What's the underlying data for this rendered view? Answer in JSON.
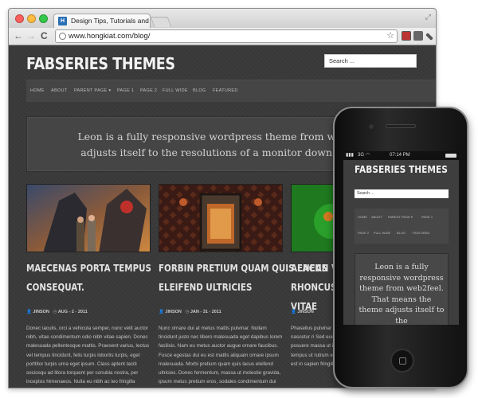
{
  "browser": {
    "tab_title": "Design Tips, Tutorials and In",
    "url": "www.hongkiat.com/blog/",
    "back_glyph": "←",
    "forward_glyph": "→",
    "reload_glyph": "C",
    "star_glyph": "☆",
    "favicon_letter": "H"
  },
  "site": {
    "logo": "FABSERIES THEMES",
    "search_placeholder": "Search ...",
    "menu": [
      "HOME",
      "ABOUT",
      "PARENT PAGE ▾",
      "PAGE 1",
      "PAGE 2",
      "FULL WIDE",
      "BLOG",
      "FEATURED"
    ],
    "intro_line1": "Leon is a fully responsive wordpress theme from web2feel. That m",
    "intro_line2": "adjusts itself to the resolutions of a monitor down to the mobile p"
  },
  "posts": [
    {
      "title_line1": "MAECENAS PORTA TEMPUS",
      "title_line2": "CONSEQUAT.",
      "author": "JINSON",
      "date": "AUG - 2 - 2011",
      "excerpt": "Donec iaculis, orci a vehicula semper, nunc velit auctor nibh, vitae condimentum odio nibh vitae sapien. Donec malesuada pellentesque mattis. Praesent varius, lectus vel tempus tincidunt, felis turpis lobortis turpis, eget porttitor turpis urna eget ipsum. Class aptent taciti sociosqu ad litora torquent per conubia nostra, per inceptos himenaeos. Nulla eu nibh ac leo fringilla tincidunt. Sed adipiscing nisl sed [...]"
    },
    {
      "title_line1": "FORBIN PRETIUM QUAM QUIS LACUS",
      "title_line2": "ELEIFEND ULTRICIES",
      "author": "JINSON",
      "date": "JAN - 31 - 2011",
      "excerpt": "Nunc ornare dui at metus mattis pulvinar. Nullam tincidunt justo nec libero malesuada eget dapibus lorem facilisis. Nam eu metus auctor augue ornare faucibus. Fusce egestas dui eu est mattis aliquam ornare ipsum malesuada. Morbi pretium quam quis lacus eleifend ultricies. Donec fermentum, massa ut molestie gravida, ipsum metus pretium eros, sodales condimentum dui risus at lectus. Suspendisse potenti. Fusce [...]"
    },
    {
      "title_line1": "AENEAN VEH",
      "title_line2": "RHONCUS TE",
      "title_line3": "VITAE",
      "author": "JINSON",
      "date": "",
      "excerpt": "Phasellus pulvinar sociis natoque penatibus nomes, nascetur ri Sed euismod; nibh venenatis sapien, egestas posuere massa ut ipsum aliquet augue. Nunc mi augue, tempus ut rutrum et, tempor non elit. Vestibulum laoreet est in sapien fringilla nec blandit"
    }
  ],
  "phone": {
    "carrier": "3G",
    "time": "07:14 PM",
    "logo": "FABSERIES THEMES",
    "search_placeholder": "Search ...",
    "menu_row1": [
      "HOME",
      "ABOUT",
      "PARENT PAGE ▾",
      "PAGE 1"
    ],
    "menu_row2": [
      "PAGE 2",
      "FULL WIDE",
      "BLOG",
      "FEATURED"
    ],
    "intro": "Leon is a fully responsive wordpress theme from web2feel. That means the theme adjusts itself to the"
  },
  "colors": {
    "page_bg": "#3a3a3a",
    "menu_bg": "#454545",
    "dot_close": "#fc605c",
    "dot_min": "#fdbc40",
    "dot_max": "#34c84a"
  }
}
